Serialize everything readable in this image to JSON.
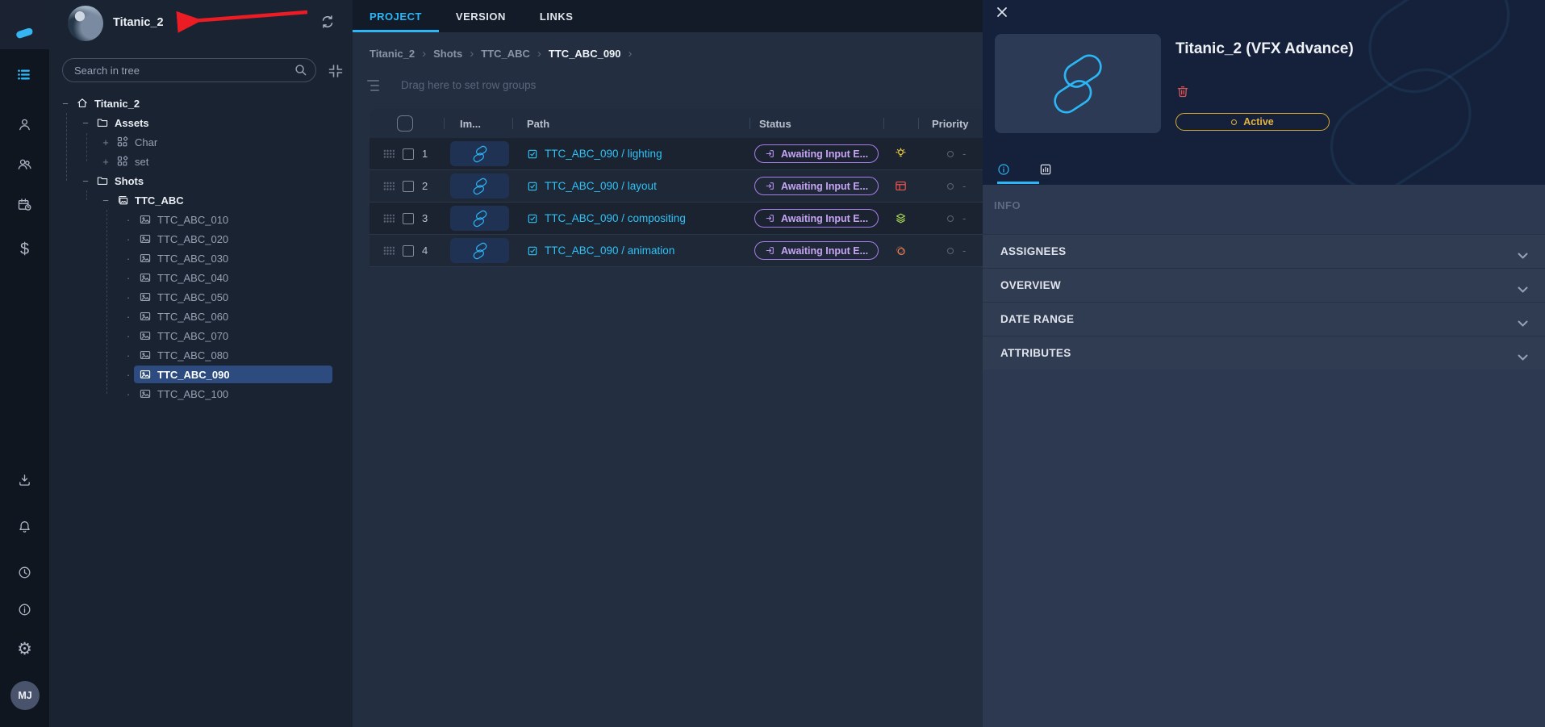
{
  "colors": {
    "accent_cyan": "#2bb7f5",
    "selection_blue": "#2d4b7e",
    "badge_purple_border": "#a87ee8",
    "badge_purple_text": "#c7a4f6",
    "active_yellow": "#e3b341",
    "danger_red": "#e25555",
    "lighting_yellow": "#e8c93f",
    "layout_red": "#ef5350",
    "compositing_green": "#a5d653",
    "animation_orange": "#ee8051",
    "annotation_red": "#ec1c24"
  },
  "rail": {
    "icons_top": [
      "app-logo",
      "list-icon",
      "person-icon",
      "people-icon",
      "calendar-clock-icon",
      "dollar-icon"
    ],
    "icons_bottom": [
      "download-icon",
      "bell-icon",
      "clock-icon",
      "info-icon",
      "gear-icon"
    ],
    "avatar_initials": "MJ"
  },
  "sidebar": {
    "project_name": "Titanic_2",
    "search_placeholder": "Search in tree",
    "tree": [
      {
        "label": "Titanic_2"
      },
      {
        "label": "Assets"
      },
      {
        "label": "Char"
      },
      {
        "label": "set"
      },
      {
        "label": "Shots"
      },
      {
        "label": "TTC_ABC"
      },
      {
        "label": "TTC_ABC_010"
      },
      {
        "label": "TTC_ABC_020"
      },
      {
        "label": "TTC_ABC_030"
      },
      {
        "label": "TTC_ABC_040"
      },
      {
        "label": "TTC_ABC_050"
      },
      {
        "label": "TTC_ABC_060"
      },
      {
        "label": "TTC_ABC_070"
      },
      {
        "label": "TTC_ABC_080"
      },
      {
        "label": "TTC_ABC_090",
        "selected": true
      },
      {
        "label": "TTC_ABC_100"
      }
    ]
  },
  "main": {
    "tabs": [
      {
        "label": "PROJECT",
        "active": true
      },
      {
        "label": "VERSION",
        "active": false
      },
      {
        "label": "LINKS",
        "active": false
      }
    ],
    "breadcrumb": {
      "items": [
        "Titanic_2",
        "Shots",
        "TTC_ABC",
        "TTC_ABC_090"
      ]
    },
    "row_group_hint": "Drag here to set row groups",
    "grid": {
      "columns": {
        "image": "Im...",
        "path": "Path",
        "status": "Status",
        "priority": "Priority"
      },
      "rows": [
        {
          "num": "1",
          "path": "TTC_ABC_090 / lighting",
          "status": "Awaiting Input E...",
          "type_icon": "lightbulb-icon",
          "priority": "-"
        },
        {
          "num": "2",
          "path": "TTC_ABC_090 / layout",
          "status": "Awaiting Input E...",
          "type_icon": "layout-icon",
          "priority": "-"
        },
        {
          "num": "3",
          "path": "TTC_ABC_090 / compositing",
          "status": "Awaiting Input E...",
          "type_icon": "layers-icon",
          "priority": "-"
        },
        {
          "num": "4",
          "path": "TTC_ABC_090 / animation",
          "status": "Awaiting Input E...",
          "type_icon": "animation-icon",
          "priority": "-"
        }
      ]
    }
  },
  "panel": {
    "title": "Titanic_2 (VFX Advance)",
    "status": "Active",
    "info_header": "INFO",
    "tabs": [
      "info-tab",
      "stats-tab"
    ],
    "sections": [
      {
        "label": "ASSIGNEES"
      },
      {
        "label": "OVERVIEW"
      },
      {
        "label": "DATE RANGE"
      },
      {
        "label": "ATTRIBUTES"
      }
    ]
  }
}
